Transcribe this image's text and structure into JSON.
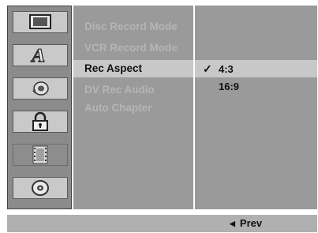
{
  "icons": [
    "tv-monitor-icon",
    "letter-a-icon",
    "speaker-icon",
    "padlock-icon",
    "film-strip-icon",
    "disc-icon"
  ],
  "menu": {
    "items": [
      {
        "label": "Disc Record Mode"
      },
      {
        "label": "VCR Record Mode"
      },
      {
        "label": "Rec Aspect"
      },
      {
        "label": "DV Rec Audio"
      },
      {
        "label": "Auto Chapter"
      }
    ],
    "selected_index": 2
  },
  "options": {
    "items": [
      {
        "label": "4:3",
        "checked": true
      },
      {
        "label": "16:9",
        "checked": false
      }
    ],
    "check_mark": "✓"
  },
  "footer": {
    "prev_arrow": "◀",
    "prev_label": "Prev"
  },
  "colors": {
    "panel": "#9a9a9a",
    "highlight": "#c8c8c8",
    "dim_text": "#b5b5b5",
    "active_text": "#101010",
    "footer": "#b0b0b0"
  }
}
